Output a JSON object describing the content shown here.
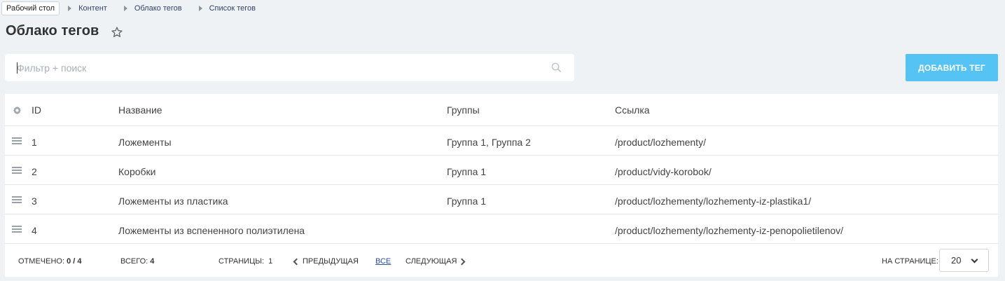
{
  "breadcrumbs": [
    "Рабочий стол",
    "Контент",
    "Облако тегов",
    "Список тегов"
  ],
  "page_title": "Облако тегов",
  "search": {
    "placeholder": "Фильтр + поиск",
    "value": ""
  },
  "add_button": "ДОБАВИТЬ ТЕГ",
  "table": {
    "columns": {
      "id": "ID",
      "name": "Название",
      "groups": "Группы",
      "link": "Ссылка"
    },
    "rows": [
      {
        "id": "1",
        "name": "Ложементы",
        "groups": "Группа 1, Группа 2",
        "link": "/product/lozhementy/"
      },
      {
        "id": "2",
        "name": "Коробки",
        "groups": "Группа 1",
        "link": "/product/vidy-korobok/"
      },
      {
        "id": "3",
        "name": "Ложементы из пластика",
        "groups": "Группа 1",
        "link": "/product/lozhementy/lozhementy-iz-plastika1/"
      },
      {
        "id": "4",
        "name": "Ложементы из вспененного полиэтилена",
        "groups": "",
        "link": "/product/lozhementy/lozhementy-iz-penopolietilenov/"
      }
    ]
  },
  "footer": {
    "checked_label": "ОТМЕЧЕНО:",
    "checked_value": "0 / 4",
    "total_label": "ВСЕГО:",
    "total_value": "4",
    "pages_label": "СТРАНИЦЫ:",
    "pages_value": "1",
    "prev": "ПРЕДЫДУЩАЯ",
    "all": "ВСЕ",
    "next": "СЛЕДУЮЩАЯ",
    "per_page_label": "НА СТРАНИЦЕ:",
    "per_page_value": "20"
  },
  "colors": {
    "accent": "#55c4f5",
    "background": "#eef2f4",
    "link": "#2a4ea0"
  },
  "icons": [
    "chevron-right-icon",
    "star-icon",
    "search-icon",
    "gear-icon",
    "drag-handle-icon",
    "chevron-left-icon",
    "chevron-down-icon"
  ]
}
